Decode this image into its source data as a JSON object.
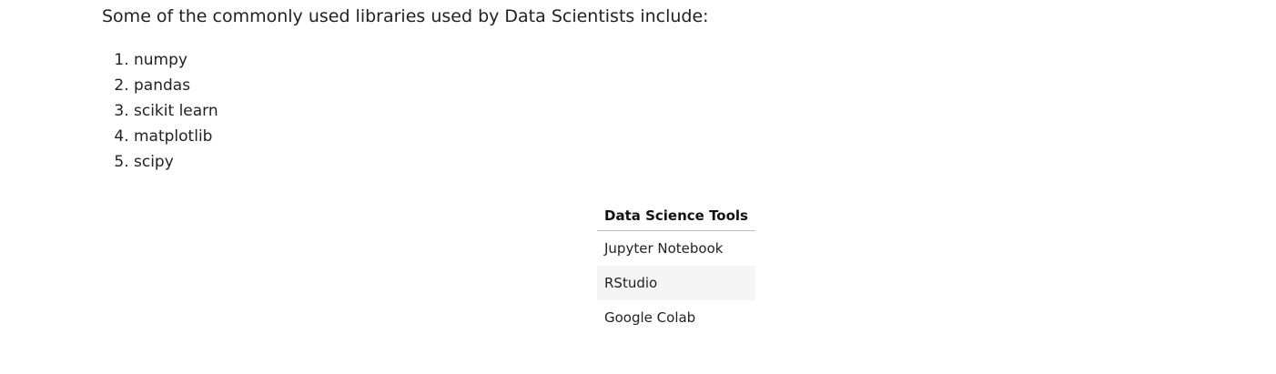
{
  "intro": "Some of the commonly used libraries used by Data Scientists include:",
  "libraries": [
    "numpy",
    "pandas",
    "scikit learn",
    "matplotlib",
    "scipy"
  ],
  "tools_table": {
    "header": "Data Science Tools",
    "rows": [
      "Jupyter Notebook",
      "RStudio",
      "Google Colab"
    ]
  },
  "colors": {
    "text": "#222222",
    "stripe": "#f5f5f5",
    "rule": "#bdbdbd"
  }
}
